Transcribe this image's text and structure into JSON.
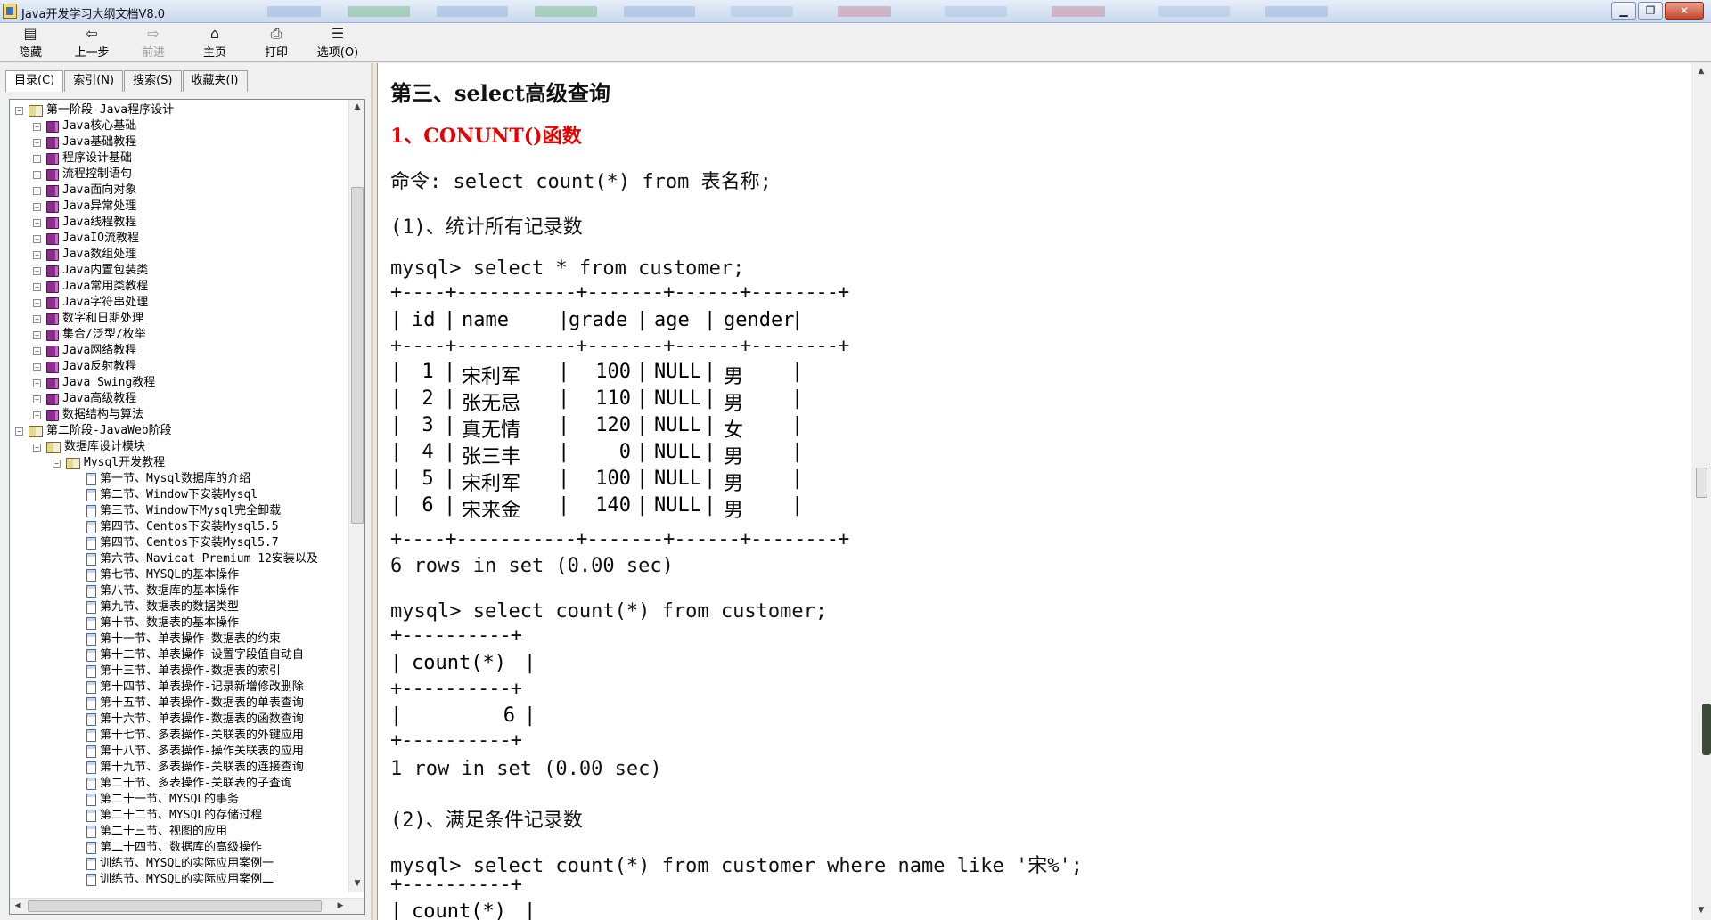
{
  "window": {
    "title": "Java开发学习大纲文档V8.0",
    "controls": [
      "▁",
      "❐",
      "✕"
    ]
  },
  "toolbar": {
    "buttons": [
      {
        "label": "隐藏",
        "icon": "hide-icon",
        "glyph": "▤",
        "enabled": true
      },
      {
        "label": "上一步",
        "icon": "back-arrow-icon",
        "glyph": "⇦",
        "enabled": true
      },
      {
        "label": "前进",
        "icon": "forward-arrow-icon",
        "glyph": "⇨",
        "enabled": false
      },
      {
        "label": "主页",
        "icon": "home-icon",
        "glyph": "⌂",
        "enabled": true
      },
      {
        "label": "打印",
        "icon": "print-icon",
        "glyph": "⎙",
        "enabled": true
      },
      {
        "label": "选项(O)",
        "icon": "options-icon",
        "glyph": "☰",
        "enabled": true
      }
    ]
  },
  "nav_tabs": [
    {
      "label": "目录(C)",
      "active": true
    },
    {
      "label": "索引(N)",
      "active": false
    },
    {
      "label": "搜索(S)",
      "active": false
    },
    {
      "label": "收藏夹(I)",
      "active": false
    }
  ],
  "tree": [
    {
      "text": "第一阶段-Java程序设计",
      "level": 0,
      "kind": "openbook",
      "toggle": "−"
    },
    {
      "text": "Java核心基础",
      "level": 1,
      "kind": "book",
      "toggle": "+"
    },
    {
      "text": "Java基础教程",
      "level": 1,
      "kind": "book",
      "toggle": "+"
    },
    {
      "text": "程序设计基础",
      "level": 1,
      "kind": "book",
      "toggle": "+"
    },
    {
      "text": "流程控制语句",
      "level": 1,
      "kind": "book",
      "toggle": "+"
    },
    {
      "text": "Java面向对象",
      "level": 1,
      "kind": "book",
      "toggle": "+"
    },
    {
      "text": "Java异常处理",
      "level": 1,
      "kind": "book",
      "toggle": "+"
    },
    {
      "text": "Java线程教程",
      "level": 1,
      "kind": "book",
      "toggle": "+"
    },
    {
      "text": "JavaIO流教程",
      "level": 1,
      "kind": "book",
      "toggle": "+"
    },
    {
      "text": "Java数组处理",
      "level": 1,
      "kind": "book",
      "toggle": "+"
    },
    {
      "text": "Java内置包装类",
      "level": 1,
      "kind": "book",
      "toggle": "+"
    },
    {
      "text": "Java常用类教程",
      "level": 1,
      "kind": "book",
      "toggle": "+"
    },
    {
      "text": "Java字符串处理",
      "level": 1,
      "kind": "book",
      "toggle": "+"
    },
    {
      "text": "数字和日期处理",
      "level": 1,
      "kind": "book",
      "toggle": "+"
    },
    {
      "text": "集合/泛型/枚举",
      "level": 1,
      "kind": "book",
      "toggle": "+"
    },
    {
      "text": "Java网络教程",
      "level": 1,
      "kind": "book",
      "toggle": "+"
    },
    {
      "text": "Java反射教程",
      "level": 1,
      "kind": "book",
      "toggle": "+"
    },
    {
      "text": "Java Swing教程",
      "level": 1,
      "kind": "book",
      "toggle": "+"
    },
    {
      "text": "Java高级教程",
      "level": 1,
      "kind": "book",
      "toggle": "+"
    },
    {
      "text": "数据结构与算法",
      "level": 1,
      "kind": "book",
      "toggle": "+"
    },
    {
      "text": "第二阶段-JavaWeb阶段",
      "level": 0,
      "kind": "openbook",
      "toggle": "−"
    },
    {
      "text": "数据库设计模块",
      "level": 1,
      "kind": "openbook",
      "toggle": "−"
    },
    {
      "text": "Mysql开发教程",
      "level": 2,
      "kind": "openbook",
      "toggle": "−"
    },
    {
      "text": "第一节、Mysql数据库的介绍",
      "level": 3,
      "kind": "page"
    },
    {
      "text": "第二节、Window下安装Mysql",
      "level": 3,
      "kind": "page"
    },
    {
      "text": "第三节、Window下Mysql完全卸载",
      "level": 3,
      "kind": "page"
    },
    {
      "text": "第四节、Centos下安装Mysql5.5",
      "level": 3,
      "kind": "page"
    },
    {
      "text": "第四节、Centos下安装Mysql5.7",
      "level": 3,
      "kind": "page"
    },
    {
      "text": "第六节、Navicat Premium 12安装以及",
      "level": 3,
      "kind": "page"
    },
    {
      "text": "第七节、MYSQL的基本操作",
      "level": 3,
      "kind": "page"
    },
    {
      "text": "第八节、数据库的基本操作",
      "level": 3,
      "kind": "page"
    },
    {
      "text": "第九节、数据表的数据类型",
      "level": 3,
      "kind": "page"
    },
    {
      "text": "第十节、数据表的基本操作",
      "level": 3,
      "kind": "page"
    },
    {
      "text": "第十一节、单表操作-数据表的约束",
      "level": 3,
      "kind": "page"
    },
    {
      "text": "第十二节、单表操作-设置字段值自动自",
      "level": 3,
      "kind": "page"
    },
    {
      "text": "第十三节、单表操作-数据表的索引",
      "level": 3,
      "kind": "page"
    },
    {
      "text": "第十四节、单表操作-记录新增修改删除",
      "level": 3,
      "kind": "page"
    },
    {
      "text": "第十五节、单表操作-数据表的单表查询",
      "level": 3,
      "kind": "page"
    },
    {
      "text": "第十六节、单表操作-数据表的函数查询",
      "level": 3,
      "kind": "page"
    },
    {
      "text": "第十七节、多表操作-关联表的外键应用",
      "level": 3,
      "kind": "page"
    },
    {
      "text": "第十八节、多表操作-操作关联表的应用",
      "level": 3,
      "kind": "page"
    },
    {
      "text": "第十九节、多表操作-关联表的连接查询",
      "level": 3,
      "kind": "page"
    },
    {
      "text": "第二十节、多表操作-关联表的子查询",
      "level": 3,
      "kind": "page"
    },
    {
      "text": "第二十一节、MYSQL的事务",
      "level": 3,
      "kind": "page"
    },
    {
      "text": "第二十二节、MYSQL的存储过程",
      "level": 3,
      "kind": "page"
    },
    {
      "text": "第二十三节、视图的应用",
      "level": 3,
      "kind": "page"
    },
    {
      "text": "第二十四节、数据库的高级操作",
      "level": 3,
      "kind": "page"
    },
    {
      "text": "训练节、MYSQL的实际应用案例一",
      "level": 3,
      "kind": "page"
    },
    {
      "text": "训练节、MYSQL的实际应用案例二",
      "level": 3,
      "kind": "page"
    }
  ],
  "content": {
    "heading": "第三、select高级查询",
    "subheading": "1、CONUNT()函数",
    "command_note": "命令: select count(*) from 表名称;",
    "step1": "(1)、统计所有记录数",
    "query1": "mysql> select * from customer;",
    "border1": "+----+-----------+-------+------+--------+",
    "table1": {
      "columns": [
        "id",
        "name",
        "grade",
        "age",
        "gender"
      ],
      "rows": [
        [
          "1",
          "宋利军",
          "100",
          "NULL",
          "男"
        ],
        [
          "2",
          "张无忌",
          "110",
          "NULL",
          "男"
        ],
        [
          "3",
          "真无情",
          "120",
          "NULL",
          "女"
        ],
        [
          "4",
          "张三丰",
          "0",
          "NULL",
          "男"
        ],
        [
          "5",
          "宋利军",
          "100",
          "NULL",
          "男"
        ],
        [
          "6",
          "宋来金",
          "140",
          "NULL",
          "男"
        ]
      ]
    },
    "result1": "6 rows in set (0.00 sec)",
    "query2": "mysql> select count(*) from customer;",
    "border2": "+----------+",
    "count_header": "count(*)",
    "count_value": "6",
    "result2": "1 row in set (0.00 sec)",
    "step2": "(2)、满足条件记录数",
    "query3": "mysql> select count(*) from customer where name like '宋%';",
    "count_header2": "count(*)"
  }
}
